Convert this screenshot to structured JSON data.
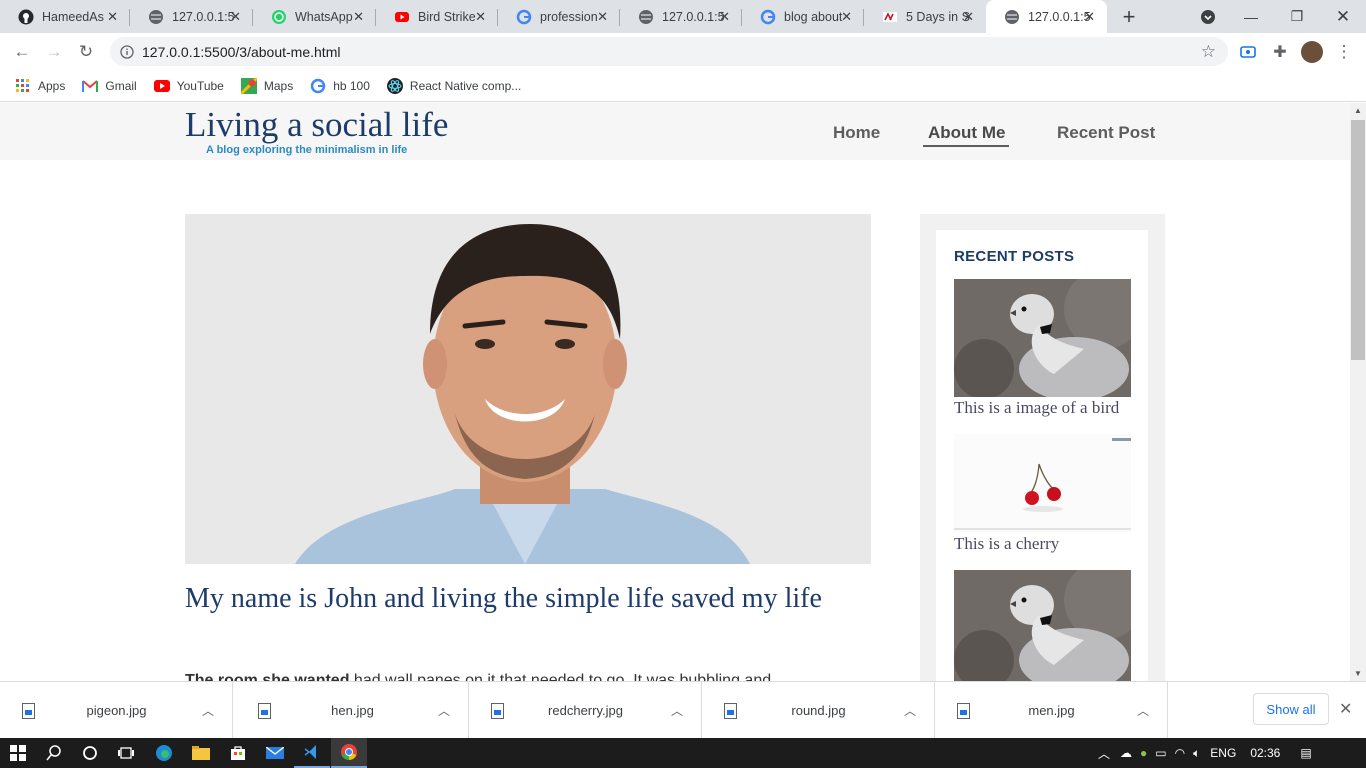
{
  "browser": {
    "tabs": [
      {
        "title": "HameedAs",
        "icon": "github-icon"
      },
      {
        "title": "127.0.0.1:5",
        "icon": "globe-icon"
      },
      {
        "title": "WhatsApp",
        "icon": "whatsapp-icon"
      },
      {
        "title": "Bird Strike",
        "icon": "youtube-icon"
      },
      {
        "title": "profession",
        "icon": "google-icon"
      },
      {
        "title": "127.0.0.1:5",
        "icon": "globe-icon"
      },
      {
        "title": "blog about",
        "icon": "google-icon"
      },
      {
        "title": "5 Days in S",
        "icon": "site-icon"
      },
      {
        "title": "127.0.0.1:5",
        "icon": "globe-icon",
        "active": true
      }
    ],
    "url": "127.0.0.1:5500/3/about-me.html",
    "bookmarks": [
      {
        "label": "Apps",
        "icon": "apps-grid-icon"
      },
      {
        "label": "Gmail",
        "icon": "gmail-icon"
      },
      {
        "label": "YouTube",
        "icon": "youtube-icon"
      },
      {
        "label": "Maps",
        "icon": "maps-icon"
      },
      {
        "label": "hb 100",
        "icon": "google-icon"
      },
      {
        "label": "React Native comp...",
        "icon": "react-icon"
      }
    ]
  },
  "site": {
    "brand": "Living a social life",
    "tagline": "A blog exploring the minimalism in life",
    "nav": [
      {
        "label": "Home",
        "active": false
      },
      {
        "label": "About Me",
        "active": true
      },
      {
        "label": "Recent Post",
        "active": false
      }
    ],
    "heading": "My name is John and living the simple life saved my life",
    "paragraph_bold": "The room she wanted",
    "paragraph_rest": " had wall panes on it that needed to go. It was bubbling and",
    "sidebar": {
      "title": "RECENT POSTS",
      "posts": [
        {
          "caption": "This is a image of a bird"
        },
        {
          "caption": "This is a cherry"
        },
        {
          "caption": ""
        }
      ]
    }
  },
  "downloads": {
    "items": [
      "pigeon.jpg",
      "hen.jpg",
      "redcherry.jpg",
      "round.jpg",
      "men.jpg"
    ],
    "show_all": "Show all"
  },
  "taskbar": {
    "lang": "ENG",
    "time": "02:36"
  },
  "colors": {
    "brand": "#1d3b6b",
    "tagline": "#2c8ac1",
    "link": "#1a73e8"
  }
}
